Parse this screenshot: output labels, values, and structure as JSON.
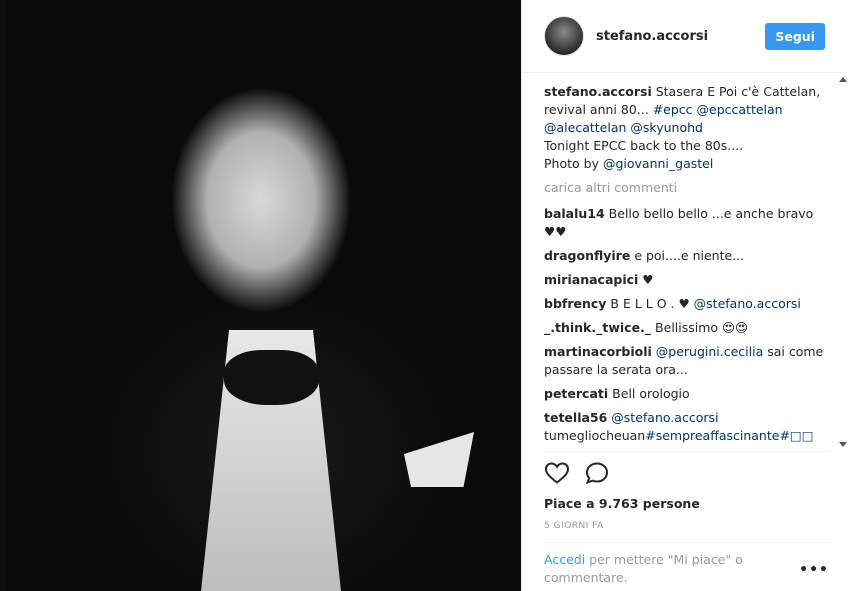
{
  "header": {
    "username": "stefano.accorsi",
    "follow_label": "Segui"
  },
  "caption": {
    "username": "stefano.accorsi",
    "line1": "Stasera E Poi c'è Cattelan, revival anni 80...",
    "tag1": "#epcc",
    "mention1": "@epccattelan",
    "mention2": "@alecattelan",
    "mention3": "@skyunohd",
    "line2": "Tonight EPCC back to the 80s....",
    "line3": "Photo by",
    "mention4": "@giovanni_gastel"
  },
  "load_more": "carica altri commenti",
  "comments": [
    {
      "user": "balalu14",
      "text": "Bello bello bello ...e anche bravo ♥♥"
    },
    {
      "user": "dragonflyire",
      "text": "e poi....e niente..."
    },
    {
      "user": "mirianacapici",
      "text": "♥"
    },
    {
      "user": "bbfrency",
      "text": "B E L L O . ♥",
      "mention": "@stefano.accorsi"
    },
    {
      "user": "_.think._twice._",
      "text": "Bellissimo 😍😍"
    },
    {
      "user": "martinacorbioli",
      "mention": "@perugini.cecilia",
      "text": "sai come passare la serata ora..."
    },
    {
      "user": "petercati",
      "text": "Bell orologio"
    },
    {
      "user": "tetella56",
      "mention": "@stefano.accorsi"
    },
    {
      "text": "tumegliocheuan",
      "tag": "#sempreaffascinante#□□"
    }
  ],
  "likes": "Piace a 9.763 persone",
  "time_ago": "5 GIORNI FA",
  "login": {
    "link": "Accedi",
    "text": "per mettere \"Mi piace\" o commentare."
  },
  "more_options": "•••",
  "icons": {
    "like": "heart-icon",
    "comment": "comment-icon"
  },
  "colors": {
    "accent": "#3897f0",
    "link": "#003569"
  }
}
